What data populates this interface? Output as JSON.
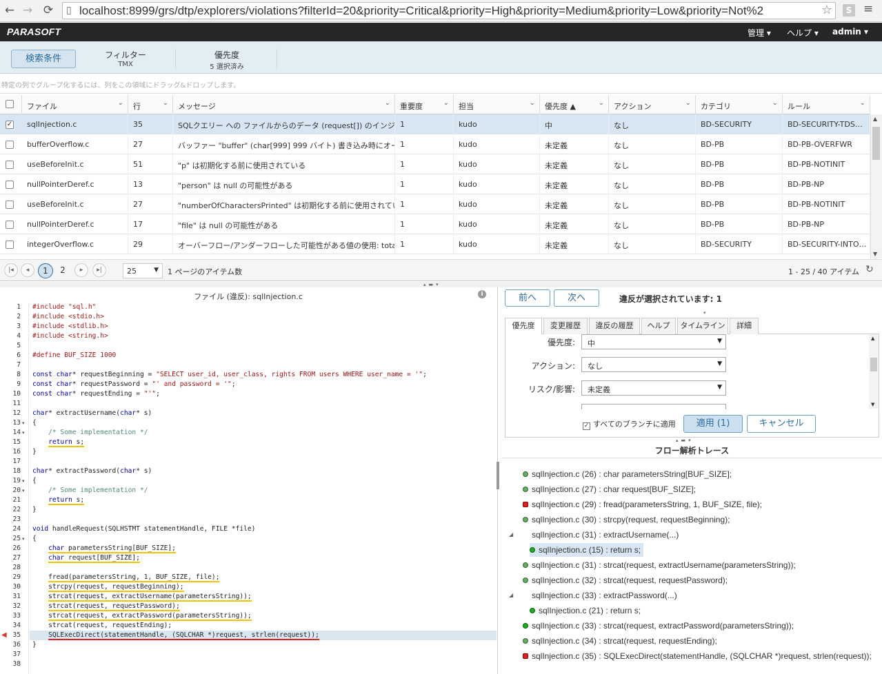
{
  "browser": {
    "url": "localhost:8999/grs/dtp/explorers/violations?filterId=20&priority=Critical&priority=High&priority=Medium&priority=Low&priority=Not%2",
    "extension_label": "S"
  },
  "topbar": {
    "logo": "PARASOFT",
    "menu": [
      "管理",
      "ヘルプ",
      "admin"
    ]
  },
  "filterbar": {
    "search_button": "検索条件",
    "filter_title": "フィルター",
    "filter_value": "TMX",
    "priority_title": "優先度",
    "priority_value": "5 選択済み"
  },
  "grid": {
    "group_hint": "特定の列でグループ化するには、列をこの領域にドラッグ&ドロップします。",
    "columns": [
      "ファイル",
      "行",
      "メッセージ",
      "重要度",
      "担当",
      "優先度 ▲",
      "アクション",
      "カテゴリ",
      "ルール"
    ],
    "rows": [
      {
        "checked": true,
        "file": "sqlInjection.c",
        "line": "35",
        "message": "SQLクエリー への ファイルからのデータ (request[]) のインジェク…",
        "severity": "1",
        "assignee": "kudo",
        "priority": "中",
        "action": "なし",
        "category": "BD-SECURITY",
        "rule": "BD-SECURITY-TDS…"
      },
      {
        "checked": false,
        "file": "bufferOverflow.c",
        "line": "27",
        "message": "バッファー \"buffer\" (char[999] 999 バイト) 書き込み時にオーバ…",
        "severity": "1",
        "assignee": "kudo",
        "priority": "未定義",
        "action": "なし",
        "category": "BD-PB",
        "rule": "BD-PB-OVERFWR"
      },
      {
        "checked": false,
        "file": "useBeforeInit.c",
        "line": "51",
        "message": "\"p\" は初期化する前に使用されている",
        "severity": "1",
        "assignee": "kudo",
        "priority": "未定義",
        "action": "なし",
        "category": "BD-PB",
        "rule": "BD-PB-NOTINIT"
      },
      {
        "checked": false,
        "file": "nullPointerDeref.c",
        "line": "13",
        "message": "\"person\" は null の可能性がある",
        "severity": "1",
        "assignee": "kudo",
        "priority": "未定義",
        "action": "なし",
        "category": "BD-PB",
        "rule": "BD-PB-NP"
      },
      {
        "checked": false,
        "file": "useBeforeInit.c",
        "line": "27",
        "message": "\"numberOfCharactersPrinted\" は初期化する前に使用されている",
        "severity": "1",
        "assignee": "kudo",
        "priority": "未定義",
        "action": "なし",
        "category": "BD-PB",
        "rule": "BD-PB-NOTINIT"
      },
      {
        "checked": false,
        "file": "nullPointerDeref.c",
        "line": "17",
        "message": "\"file\" は null の可能性がある",
        "severity": "1",
        "assignee": "kudo",
        "priority": "未定義",
        "action": "なし",
        "category": "BD-PB",
        "rule": "BD-PB-NP"
      },
      {
        "checked": false,
        "file": "integerOverflow.c",
        "line": "29",
        "message": "オーバーフロー/アンダーフローした可能性がある値の使用: total…",
        "severity": "1",
        "assignee": "kudo",
        "priority": "未定義",
        "action": "なし",
        "category": "BD-SECURITY",
        "rule": "BD-SECURITY-INTO…"
      }
    ]
  },
  "pager": {
    "pages": [
      "1",
      "2"
    ],
    "current_page": "1",
    "page_size": "25",
    "page_size_label": "1 ページのアイテム数",
    "summary": "1 - 25 / 40 アイテム"
  },
  "code": {
    "title": "ファイル (違反): sqlInjection.c",
    "info_icon": "i",
    "lines": [
      {
        "n": "1",
        "t": "#include \"sql.h\""
      },
      {
        "n": "2",
        "t": "#include <stdio.h>"
      },
      {
        "n": "3",
        "t": "#include <stdlib.h>"
      },
      {
        "n": "4",
        "t": "#include <string.h>"
      },
      {
        "n": "5",
        "t": ""
      },
      {
        "n": "6",
        "t": "#define BUF_SIZE 1000"
      },
      {
        "n": "7",
        "t": ""
      },
      {
        "n": "8",
        "t": "const char* requestBeginning = \"SELECT user_id, user_class, rights FROM users WHERE user_name = '\";"
      },
      {
        "n": "9",
        "t": "const char* requestPassword = \"' and password = '\";"
      },
      {
        "n": "10",
        "t": "const char* requestEnding = \"'\";"
      },
      {
        "n": "11",
        "t": ""
      },
      {
        "n": "12",
        "t": "char* extractUsername(char* s)"
      },
      {
        "n": "13",
        "t": "{"
      },
      {
        "n": "14",
        "t": "    /* Some implementation */"
      },
      {
        "n": "15",
        "t": "    return s;"
      },
      {
        "n": "16",
        "t": "}"
      },
      {
        "n": "17",
        "t": ""
      },
      {
        "n": "18",
        "t": "char* extractPassword(char* s)"
      },
      {
        "n": "19",
        "t": "{"
      },
      {
        "n": "20",
        "t": "    /* Some implementation */"
      },
      {
        "n": "21",
        "t": "    return s;"
      },
      {
        "n": "22",
        "t": "}"
      },
      {
        "n": "23",
        "t": ""
      },
      {
        "n": "24",
        "t": "void handleRequest(SQLHSTMT statementHandle, FILE *file)"
      },
      {
        "n": "25",
        "t": "{"
      },
      {
        "n": "26",
        "t": "    char parametersString[BUF_SIZE];"
      },
      {
        "n": "27",
        "t": "    char request[BUF_SIZE];"
      },
      {
        "n": "28",
        "t": ""
      },
      {
        "n": "29",
        "t": "    fread(parametersString, 1, BUF_SIZE, file);"
      },
      {
        "n": "30",
        "t": "    strcpy(request, requestBeginning);"
      },
      {
        "n": "31",
        "t": "    strcat(request, extractUsername(parametersString));"
      },
      {
        "n": "32",
        "t": "    strcat(request, requestPassword);"
      },
      {
        "n": "33",
        "t": "    strcat(request, extractPassword(parametersString));"
      },
      {
        "n": "34",
        "t": "    strcat(request, requestEnding);"
      },
      {
        "n": "35",
        "t": "    SQLExecDirect(statementHandle, (SQLCHAR *)request, strlen(request));"
      },
      {
        "n": "36",
        "t": "}"
      },
      {
        "n": "37",
        "t": ""
      },
      {
        "n": "38",
        "t": ""
      }
    ]
  },
  "violation_panel": {
    "prev": "前へ",
    "next": "次へ",
    "selected_text": "違反が選択されています: 1",
    "tabs": [
      "優先度",
      "変更履歴",
      "違反の履歴",
      "ヘルプ",
      "タイムライン",
      "詳細"
    ],
    "fields": [
      {
        "label": "優先度:",
        "value": "中"
      },
      {
        "label": "アクション:",
        "value": "なし"
      },
      {
        "label": "リスク/影響:",
        "value": "未定義"
      }
    ],
    "apply_all": "すべてのブランチに適用",
    "apply": "適用 (1)",
    "cancel": "キャンセル"
  },
  "flow": {
    "title": "フロー解析トレース",
    "items": [
      {
        "text": "sqlInjection.c (26) : char parametersString[BUF_SIZE];",
        "icon": "g",
        "indent": 0
      },
      {
        "text": "sqlInjection.c (27) : char request[BUF_SIZE];",
        "icon": "g",
        "indent": 0
      },
      {
        "text": "sqlInjection.c (29) : fread(parametersString, 1, BUF_SIZE, file);",
        "icon": "r",
        "indent": 0
      },
      {
        "text": "sqlInjection.c (30) : strcpy(request, requestBeginning);",
        "icon": "g",
        "indent": 0
      },
      {
        "text": "sqlInjection.c (31) : extractUsername(...)",
        "icon": "",
        "indent": 0
      },
      {
        "text": "sqlInjection.c (15) : return s;",
        "icon": "gd",
        "indent": 1
      },
      {
        "text": "sqlInjection.c (31) : strcat(request, extractUsername(parametersString));",
        "icon": "g",
        "indent": 0
      },
      {
        "text": "sqlInjection.c (32) : strcat(request, requestPassword);",
        "icon": "g",
        "indent": 0
      },
      {
        "text": "sqlInjection.c (33) : extractPassword(...)",
        "icon": "",
        "indent": 0
      },
      {
        "text": "sqlInjection.c (21) : return s;",
        "icon": "gd",
        "indent": 1
      },
      {
        "text": "sqlInjection.c (33) : strcat(request, extractPassword(parametersString));",
        "icon": "gd",
        "indent": 0
      },
      {
        "text": "sqlInjection.c (34) : strcat(request, requestEnding);",
        "icon": "g",
        "indent": 0
      },
      {
        "text": "sqlInjection.c (35) : SQLExecDirect(statementHandle, (SQLCHAR *)request, strlen(request));",
        "icon": "r",
        "indent": 0
      }
    ]
  }
}
